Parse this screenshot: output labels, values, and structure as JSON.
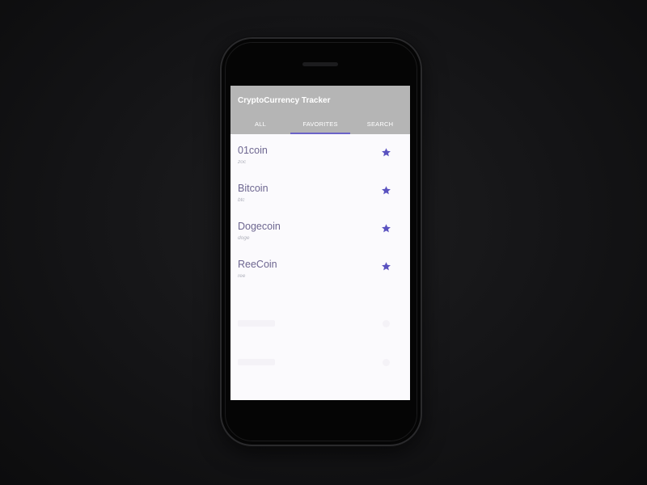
{
  "app": {
    "title": "CryptoCurrency Tracker"
  },
  "tabs": [
    {
      "label": "ALL",
      "selected": false
    },
    {
      "label": "FAVORITES",
      "selected": true
    },
    {
      "label": "SEARCH",
      "selected": false
    }
  ],
  "coins": [
    {
      "name": "01coin",
      "symbol": "zoc",
      "favorite": true
    },
    {
      "name": "Bitcoin",
      "symbol": "btc",
      "favorite": true
    },
    {
      "name": "Dogecoin",
      "symbol": "doge",
      "favorite": true
    },
    {
      "name": "ReeCoin",
      "symbol": "ree",
      "favorite": true
    }
  ],
  "colors": {
    "app_bar": "#b5b5b5",
    "accent": "#6b63c8",
    "star": "#5a52c0",
    "coin_name": "#6d6690",
    "coin_symbol": "#aeb0bb",
    "screen_background": "#fbfafd"
  },
  "icons": {
    "favorite": "star-icon"
  }
}
